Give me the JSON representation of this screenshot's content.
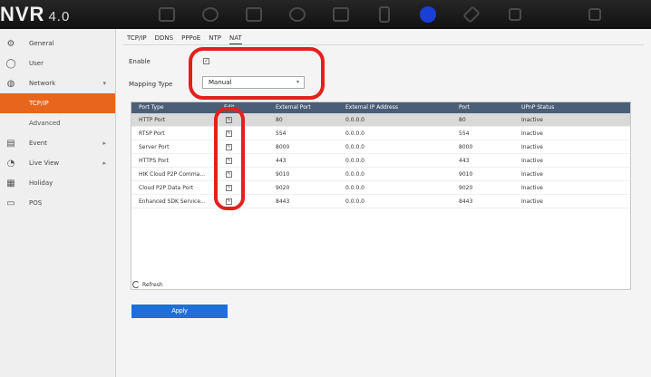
{
  "app": {
    "brand": "NVR",
    "version": "4.0"
  },
  "sidebar": {
    "items": [
      {
        "label": "General",
        "icon": "gear-icon"
      },
      {
        "label": "User",
        "icon": "user-icon"
      },
      {
        "label": "Network",
        "icon": "globe-icon"
      },
      {
        "label": "Event",
        "icon": "event-icon"
      },
      {
        "label": "Live View",
        "icon": "live-view-icon"
      },
      {
        "label": "Holiday",
        "icon": "calendar-icon"
      },
      {
        "label": "POS",
        "icon": "pos-icon"
      }
    ],
    "sub": {
      "tcpip": "TCP/IP",
      "advanced": "Advanced"
    }
  },
  "tabs": [
    "TCP/IP",
    "DDNS",
    "PPPoE",
    "NTP",
    "NAT"
  ],
  "form": {
    "enable_label": "Enable",
    "mapping_label": "Mapping Type",
    "mapping_value": "Manual"
  },
  "table": {
    "headers": [
      "Port Type",
      "Edit",
      "External Port",
      "External IP Address",
      "Port",
      "UPnP Status"
    ],
    "rows": [
      {
        "type": "HTTP Port",
        "ext": "80",
        "ip": "0.0.0.0",
        "port": "80",
        "status": "Inactive"
      },
      {
        "type": "RTSP Port",
        "ext": "554",
        "ip": "0.0.0.0",
        "port": "554",
        "status": "Inactive"
      },
      {
        "type": "Server Port",
        "ext": "8000",
        "ip": "0.0.0.0",
        "port": "8000",
        "status": "Inactive"
      },
      {
        "type": "HTTPS Port",
        "ext": "443",
        "ip": "0.0.0.0",
        "port": "443",
        "status": "Inactive"
      },
      {
        "type": "HIK Cloud P2P Comma...",
        "ext": "9010",
        "ip": "0.0.0.0",
        "port": "9010",
        "status": "Inactive"
      },
      {
        "type": "Cloud P2P Data Port",
        "ext": "9020",
        "ip": "0.0.0.0",
        "port": "9020",
        "status": "Inactive"
      },
      {
        "type": "Enhanced SDK Service...",
        "ext": "8443",
        "ip": "0.0.0.0",
        "port": "8443",
        "status": "Inactive"
      }
    ]
  },
  "refresh_label": "Refresh",
  "apply_label": "Apply",
  "colors": {
    "accent": "#e8661c",
    "apply": "#1f6fd9",
    "header": "#4a5e78",
    "annotation": "#e3201b"
  }
}
